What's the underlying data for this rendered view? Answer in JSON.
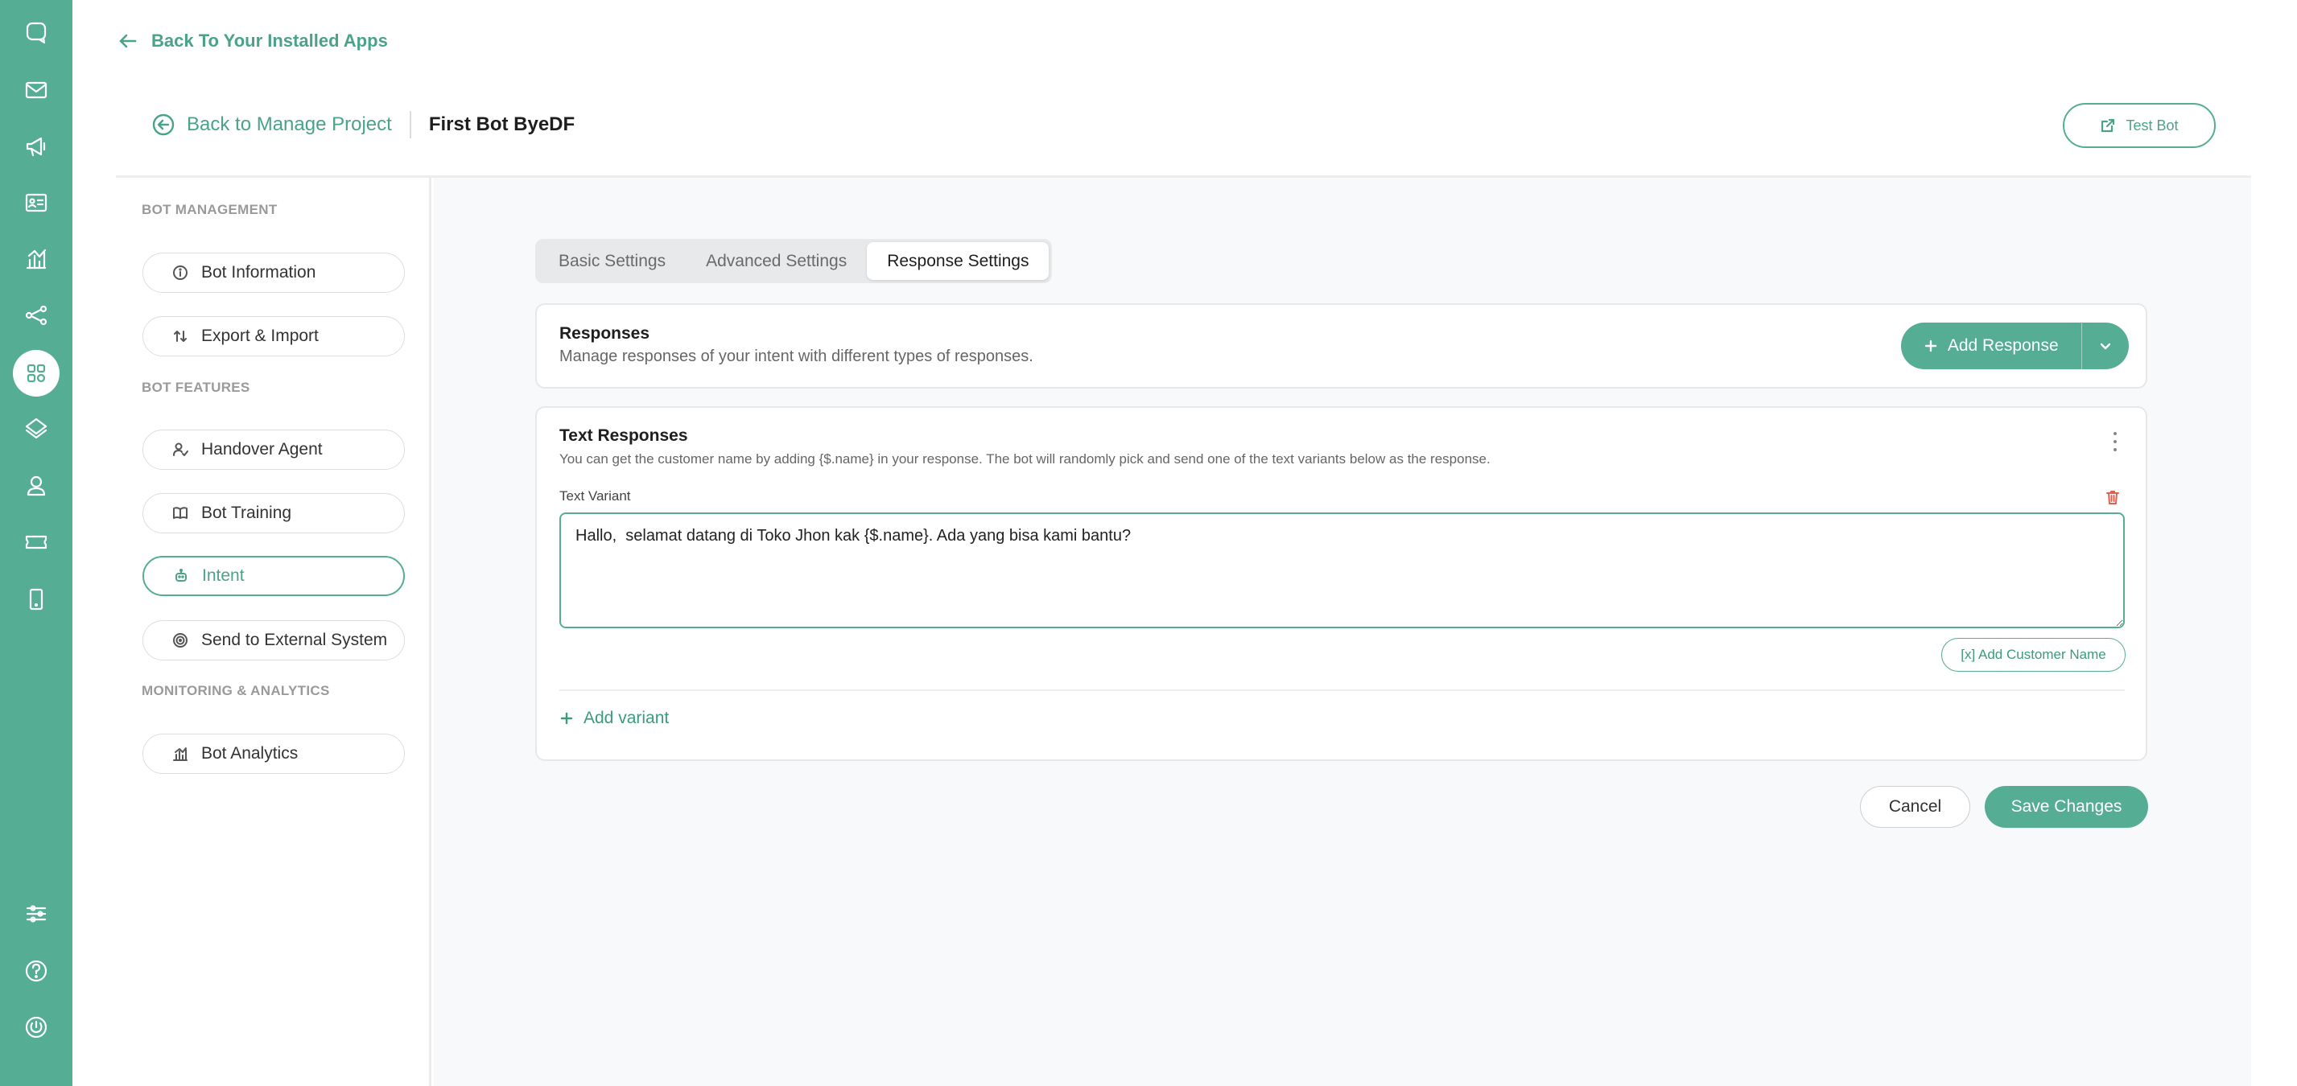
{
  "rail": {
    "icons": [
      "chat-icon",
      "mail-icon",
      "megaphone-icon",
      "contact-card-icon",
      "analytics-chart-icon",
      "flow-share-icon",
      "apps-grid-icon",
      "layers-icon",
      "agent-icon",
      "ticket-icon",
      "mobile-icon",
      "sliders-icon",
      "help-icon",
      "power-icon"
    ],
    "active": "apps-grid-icon"
  },
  "nav": {
    "back_apps": "Back To Your Installed Apps",
    "back_manage": "Back to Manage Project",
    "bot_name": "First Bot ByeDF",
    "test_bot": "Test Bot"
  },
  "sidebar": {
    "sections": {
      "management": "BOT MANAGEMENT",
      "features": "BOT FEATURES",
      "monitoring": "MONITORING & ANALYTICS"
    },
    "items": [
      {
        "label": "Bot Information",
        "icon": "info-icon"
      },
      {
        "label": "Export & Import",
        "icon": "swap-vertical-icon"
      },
      {
        "label": "Handover Agent",
        "icon": "user-check-icon"
      },
      {
        "label": "Bot Training",
        "icon": "book-icon"
      },
      {
        "label": "Intent",
        "icon": "bot-head-icon"
      },
      {
        "label": "Send to External System",
        "icon": "target-icon"
      },
      {
        "label": "Bot Analytics",
        "icon": "bar-chart-icon"
      }
    ],
    "active": "Intent"
  },
  "tabs": [
    "Basic Settings",
    "Advanced Settings",
    "Response Settings"
  ],
  "active_tab": "Response Settings",
  "responses": {
    "title": "Responses",
    "description": "Manage responses of your intent with different types of responses.",
    "add_button": "Add Response"
  },
  "text_responses": {
    "title": "Text Responses",
    "description": "You can get the customer name by adding {$.name} in your response. The bot will randomly pick and send one of the text variants below as the response.",
    "variant_label": "Text Variant",
    "variant_value": "Hallo,  selamat datang di Toko Jhon kak {$.name}. Ada yang bisa kami bantu?",
    "add_customer_name": "[x] Add Customer Name",
    "add_variant": "Add variant"
  },
  "actions": {
    "cancel": "Cancel",
    "save": "Save Changes"
  },
  "colors": {
    "brand": "#55ad93",
    "brand_text": "#4aa389",
    "danger": "#e0604f"
  }
}
